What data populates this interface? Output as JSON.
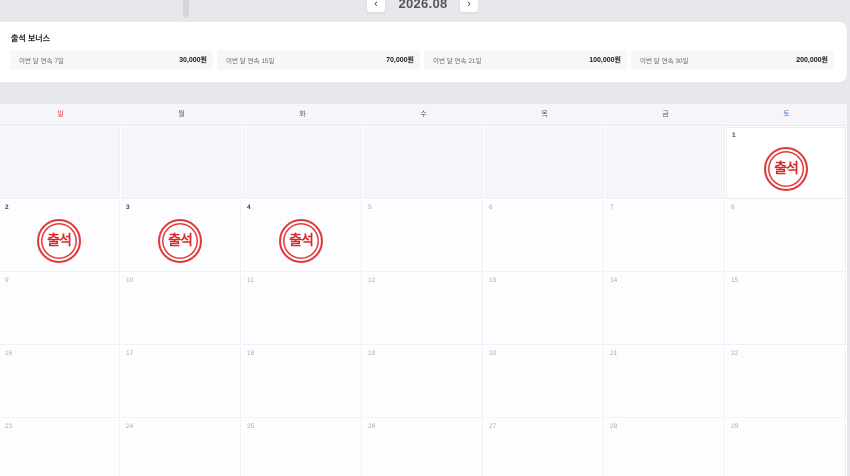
{
  "month_nav": {
    "prev_icon": "‹",
    "next_icon": "›",
    "title": "2026.08"
  },
  "bonus": {
    "title": "출석 보너스",
    "items": [
      {
        "label": "이번 달 연속 7일",
        "value": "30,000원"
      },
      {
        "label": "이번 달 연속 15일",
        "value": "70,000원"
      },
      {
        "label": "이번 달 연속 21일",
        "value": "100,000원"
      },
      {
        "label": "이번 달 연속 30일",
        "value": "200,000원"
      }
    ]
  },
  "calendar": {
    "weekdays": [
      "일",
      "월",
      "화",
      "수",
      "목",
      "금",
      "토"
    ],
    "weekday_colors": {
      "sun": "#e03a3a",
      "sat": "#4a78c8",
      "default": "#555555"
    },
    "stamp_text": "출석",
    "stamp_color": "#e03a3a",
    "attended_days": [
      1,
      2,
      3,
      4
    ],
    "weeks": [
      [
        "",
        "",
        "",
        "",
        "",
        "",
        "1"
      ],
      [
        "2",
        "3",
        "4",
        "5",
        "6",
        "7",
        "8"
      ],
      [
        "9",
        "10",
        "11",
        "12",
        "13",
        "14",
        "15"
      ],
      [
        "16",
        "17",
        "18",
        "19",
        "20",
        "21",
        "22"
      ],
      [
        "23",
        "24",
        "25",
        "26",
        "27",
        "28",
        "29"
      ]
    ]
  }
}
